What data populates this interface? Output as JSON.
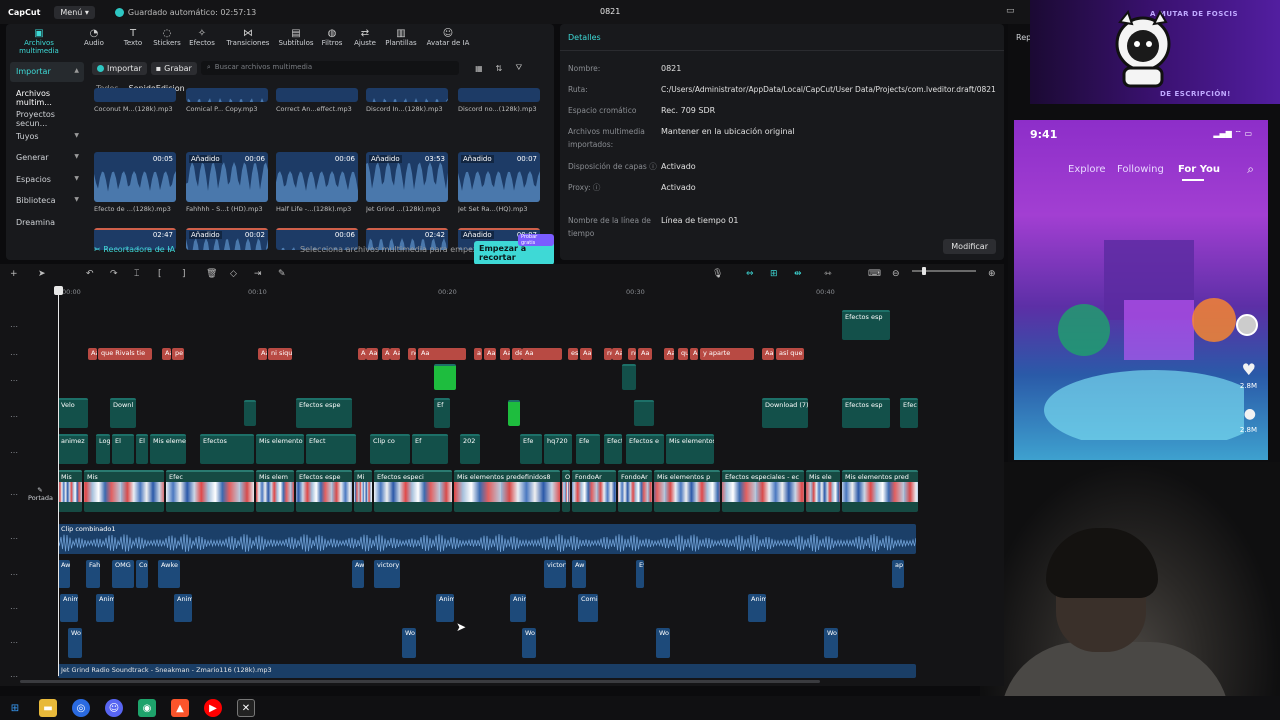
{
  "app": {
    "logo": "CapCut",
    "menu_label": "Menú",
    "autosave": "Guardado automático: 02:57:13",
    "project_title": "0821"
  },
  "tools": [
    {
      "label": "Archivos multimedia",
      "icon": "media-icon"
    },
    {
      "label": "Audio",
      "icon": "audio-icon"
    },
    {
      "label": "Texto",
      "icon": "text-icon"
    },
    {
      "label": "Stickers",
      "icon": "sticker-icon"
    },
    {
      "label": "Efectos",
      "icon": "effects-icon"
    },
    {
      "label": "Transiciones",
      "icon": "transitions-icon"
    },
    {
      "label": "Subtítulos",
      "icon": "subtitles-icon"
    },
    {
      "label": "Filtros",
      "icon": "filters-icon"
    },
    {
      "label": "Ajuste",
      "icon": "adjust-icon"
    },
    {
      "label": "Plantillas",
      "icon": "templates-icon"
    },
    {
      "label": "Avatar de IA",
      "icon": "avatar-icon"
    }
  ],
  "sidebar": [
    {
      "label": "Importar"
    },
    {
      "label": "Archivos multim..."
    },
    {
      "label": "Proyectos secun..."
    },
    {
      "label": "Tuyos"
    },
    {
      "label": "Generar"
    },
    {
      "label": "Espacios"
    },
    {
      "label": "Biblioteca"
    },
    {
      "label": "Dreamina"
    }
  ],
  "media_toolbar": {
    "import": "Importar",
    "record": "Grabar",
    "search_placeholder": "Buscar archivos multimedia"
  },
  "filters": {
    "all": "Todos",
    "sound": "SonidoEdicion"
  },
  "media_rows": [
    [
      {
        "name": "Coconut M...(128k).mp3",
        "badge": "",
        "dur": ""
      },
      {
        "name": "Comical P... Copy.mp3",
        "badge": "",
        "dur": ""
      },
      {
        "name": "Correct An...effect.mp3",
        "badge": "",
        "dur": ""
      },
      {
        "name": "Discord In...(128k).mp3",
        "badge": "",
        "dur": ""
      },
      {
        "name": "Discord no...(128k).mp3",
        "badge": "",
        "dur": ""
      }
    ],
    [
      {
        "name": "Efecto de ...(128k).mp3",
        "badge": "",
        "dur": "00:05"
      },
      {
        "name": "Fahhhh - S...t (HD).mp3",
        "badge": "Añadido",
        "dur": "00:06"
      },
      {
        "name": "Half Life -...(128k).mp3",
        "badge": "",
        "dur": "00:06"
      },
      {
        "name": "Jet Grind ...(128k).mp3",
        "badge": "Añadido",
        "dur": "03:53"
      },
      {
        "name": "Jet Set Ra...(HQ).mp3",
        "badge": "Añadido",
        "dur": "00:07"
      }
    ],
    [
      {
        "name": "",
        "badge": "",
        "dur": "02:47"
      },
      {
        "name": "",
        "badge": "Añadido",
        "dur": "00:02"
      },
      {
        "name": "",
        "badge": "",
        "dur": "00:06"
      },
      {
        "name": "",
        "badge": "",
        "dur": "02:42"
      },
      {
        "name": "",
        "badge": "Añadido",
        "dur": "00:07"
      }
    ]
  ],
  "media_footer": {
    "ai_recorder": "Recortadora de IA",
    "hint": "Selecciona archivos multimedia para empezar",
    "start_button": "Empezar a recortar",
    "trial_badge": "Probar gratis"
  },
  "details": {
    "header": "Detalles",
    "rows": [
      {
        "label": "Nombre:",
        "value": "0821"
      },
      {
        "label": "Ruta:",
        "value": "C:/Users/Administrator/AppData/Local/CapCut/User Data/Projects/com.lveditor.draft/0821"
      },
      {
        "label": "Espacio cromático",
        "value": "Rec. 709 SDR"
      },
      {
        "label": "Archivos multimedia importados:",
        "value": "Mantener en la ubicación original"
      },
      {
        "label": "Disposición de capas",
        "value": "Activado"
      },
      {
        "label": "Proxy:",
        "value": "Activado"
      },
      {
        "label": "Nombre de la línea de tiempo",
        "value": "Línea de tiempo 01"
      }
    ],
    "modify_button": "Modificar"
  },
  "player": {
    "rep_label": "Rep"
  },
  "banner": {
    "top_text": "A MUTAR DE FOSCIS",
    "bottom_text": "DE ESCRIPCIÓN!"
  },
  "phone": {
    "time": "9:41",
    "tabs": [
      "Explore",
      "Following",
      "For You"
    ],
    "likes": "2.8M",
    "comments": "2.8M"
  },
  "timeline": {
    "ruler": [
      "00:00",
      "00:10",
      "00:20",
      "00:30",
      "00:40"
    ],
    "cover_label": "Portada",
    "red_texts": [
      "Aa",
      "que Rivals tie",
      "Aa",
      "pe",
      "Aa",
      "ni siqu",
      "Aa",
      "Aa",
      "Aa",
      "Aa",
      "no quiere c",
      "Aa",
      "a",
      "Aa",
      "Aa",
      "de Hallov",
      "Aa",
      "es c",
      "Aa",
      "nu",
      "Aa",
      "nue",
      "Aa",
      "Aa",
      "que soporta",
      "Aa",
      "y aparte",
      "Aa",
      "así que"
    ],
    "fx_top": [
      "Efectos esp"
    ],
    "teal_row1": [
      "Velo",
      "Downl",
      "Efectos espe",
      "Ef",
      "Download (7)",
      "Efectos esp",
      "Efec"
    ],
    "teal_row2": [
      "animez",
      "Log",
      "El",
      "El",
      "Mis elementos p",
      "Efectos",
      "Mis elemento",
      "Efect",
      "Clip co",
      "Ef",
      "202",
      "Efe",
      "hq720",
      "Efe",
      "Efect",
      "Efectos e",
      "Mis elementos pred"
    ],
    "video_row": [
      "Mis",
      "Mis",
      "Efec",
      "Mis elem",
      "Efectos espe",
      "Mi",
      "Efectos especi",
      "Mis elementos predefinidos8",
      "Or",
      "FondoAr",
      "FondoAr",
      "Mis elementos p",
      "Efectos especiales - ec",
      "Mis ele",
      "Mis elementos pred"
    ],
    "combined_label": "Clip combinado1",
    "audio1": [
      "Aw",
      "Fah",
      "OMG",
      "Co",
      "Awke",
      "Aw",
      "victory",
      "victory",
      "Aw",
      "Ev",
      "ap"
    ],
    "audio2": [
      "Anim",
      "Anim",
      "Anim",
      "Anim",
      "Anim",
      "Comi",
      "Anim"
    ],
    "audio3": [
      "Wo",
      "Wo",
      "Wo",
      "Wo",
      "Wo"
    ],
    "music_label": "Jet Grind Radio Soundtrack - Sneakman - Zmario116 (128k).mp3"
  },
  "colors": {
    "accent": "#3ed9d6",
    "clip_red": "#b84a43",
    "clip_teal": "#13504a",
    "audio_blue": "#1d4a7a"
  }
}
